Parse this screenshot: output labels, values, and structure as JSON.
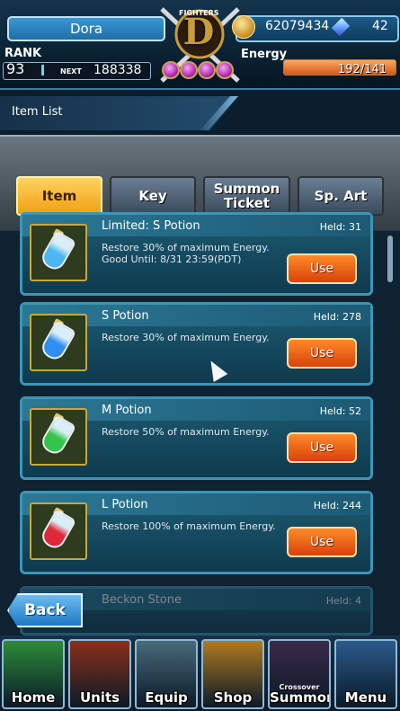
{
  "colors": {
    "accent": "#3c96b6",
    "tab_active": "#f0a012",
    "use_button": "#d8420a",
    "energy": "#d1591c"
  },
  "header": {
    "player_name": "Dora",
    "rank_label": "RANK",
    "rank_value": "93",
    "next_label": "NEXT",
    "next_value": "188338",
    "emblem_text": "FIGHTERS",
    "emblem_letter": "D",
    "coins": "62079434",
    "crystals": "42",
    "energy_label": "Energy",
    "energy_text": "192/141",
    "energy_fraction": 1.0,
    "coin_icon": "coin-icon",
    "crystal_icon": "crystal-icon"
  },
  "page": {
    "title": "Item List"
  },
  "tabs": [
    {
      "label": "Item",
      "active": true
    },
    {
      "label": "Key",
      "active": false
    },
    {
      "label": "Summon Ticket",
      "active": false
    },
    {
      "label": "Sp. Art",
      "active": false
    }
  ],
  "items": [
    {
      "name": "Limited: S Potion",
      "held": "Held: 31",
      "description": "Restore 30% of maximum Energy. Good Until: 8/31 23:59(PDT)",
      "action": "Use",
      "potion_color": "#4bb6f0"
    },
    {
      "name": "S Potion",
      "held": "Held: 278",
      "description": "Restore 30% of maximum Energy.",
      "action": "Use",
      "potion_color": "#2f8ff0"
    },
    {
      "name": "M Potion",
      "held": "Held: 52",
      "description": "Restore 50% of maximum Energy.",
      "action": "Use",
      "potion_color": "#34c44a"
    },
    {
      "name": "L Potion",
      "held": "Held: 244",
      "description": "Restore 100% of maximum Energy.",
      "action": "Use",
      "potion_color": "#e0283a"
    },
    {
      "name": "Beckon Stone",
      "held": "Held: 4",
      "description": "",
      "action": "",
      "potion_color": "#888888"
    }
  ],
  "back_button": "Back",
  "nav": [
    {
      "label": "Home",
      "sub": "",
      "icon": "home-icon",
      "color": "#2e8b3a"
    },
    {
      "label": "Units",
      "sub": "",
      "icon": "units-icon",
      "color": "#8a2f1a"
    },
    {
      "label": "Equip",
      "sub": "",
      "icon": "equip-icon",
      "color": "#4a6a7a"
    },
    {
      "label": "Shop",
      "sub": "",
      "icon": "shop-icon",
      "color": "#b07a20"
    },
    {
      "label": "Summon",
      "sub": "Crossover",
      "icon": "summon-icon",
      "color": "#3a2a4a"
    },
    {
      "label": "Menu",
      "sub": "",
      "icon": "menu-icon",
      "color": "#2a5a8a"
    }
  ]
}
